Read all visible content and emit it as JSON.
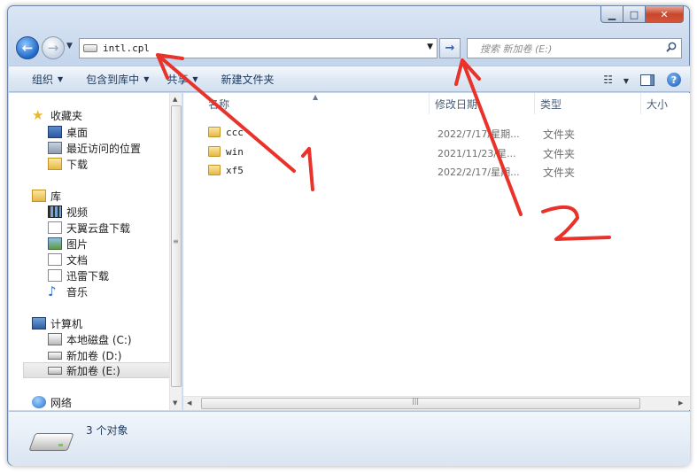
{
  "window": {
    "caption": {
      "minimize": "▁",
      "maximize": "□",
      "close": "✕"
    }
  },
  "nav": {
    "back": "←",
    "forward": "→",
    "history_drop": "▼",
    "address": "intl.cpl",
    "address_drop": "▼",
    "go": "→",
    "search_placeholder": "搜索 新加卷 (E:)"
  },
  "toolbar": {
    "organize": "组织",
    "include_library": "包含到库中",
    "share": "共享",
    "new_folder": "新建文件夹",
    "dropdown_arrow": "▼",
    "view_icon": "☷",
    "help": "?"
  },
  "sidebar": {
    "favorites": {
      "label": "收藏夹",
      "items": [
        "桌面",
        "最近访问的位置",
        "下载"
      ]
    },
    "libraries": {
      "label": "库",
      "items": [
        "视频",
        "天翼云盘下载",
        "图片",
        "文档",
        "迅雷下载",
        "音乐"
      ]
    },
    "computer": {
      "label": "计算机",
      "items": [
        "本地磁盘 (C:)",
        "新加卷 (D:)",
        "新加卷 (E:)"
      ],
      "selected_index": 2
    },
    "network": {
      "label": "网络"
    }
  },
  "columns": {
    "name": "名称",
    "date": "修改日期",
    "type": "类型",
    "size": "大小"
  },
  "files": [
    {
      "name": "ccc",
      "date": "2022/7/17/星期...",
      "type": "文件夹"
    },
    {
      "name": "win",
      "date": "2021/11/23/星...",
      "type": "文件夹"
    },
    {
      "name": "xf5",
      "date": "2022/2/17/星期...",
      "type": "文件夹"
    }
  ],
  "details": {
    "count": "3 个对象"
  },
  "annotations": {
    "label_1": "1",
    "label_2": "2",
    "color": "#e8322a"
  }
}
